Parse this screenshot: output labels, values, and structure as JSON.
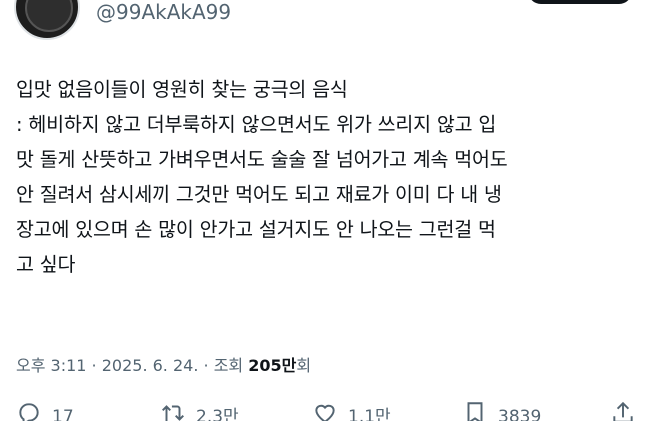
{
  "user": {
    "handle": "@99AkAkA99"
  },
  "tweet": {
    "lines": [
      "입맛 없음이들이 영원히 찾는 궁극의 음식",
      ": 헤비하지 않고 더부룩하지 않으면서도 위가 쓰리지 않고 입",
      "맛 돌게 산뜻하고 가벼우면서도 술술 잘 넘어가고 계속 먹어도",
      "안 질려서 삼시세끼 그것만 먹어도 되고 재료가 이미 다 내 냉",
      "장고에 있으며 손 많이 안가고 설거지도 안 나오는 그런걸 먹",
      "고 싶다"
    ]
  },
  "meta": {
    "time": "오후 3:11",
    "sep1": " · ",
    "date": "2025. 6. 24.",
    "sep2": " · ",
    "views_label": "조회 ",
    "views_count": "205만",
    "views_suffix": "회"
  },
  "actions": {
    "replies": "17",
    "reposts": "2.3만",
    "likes": "1.1만",
    "bookmarks": "3839"
  }
}
